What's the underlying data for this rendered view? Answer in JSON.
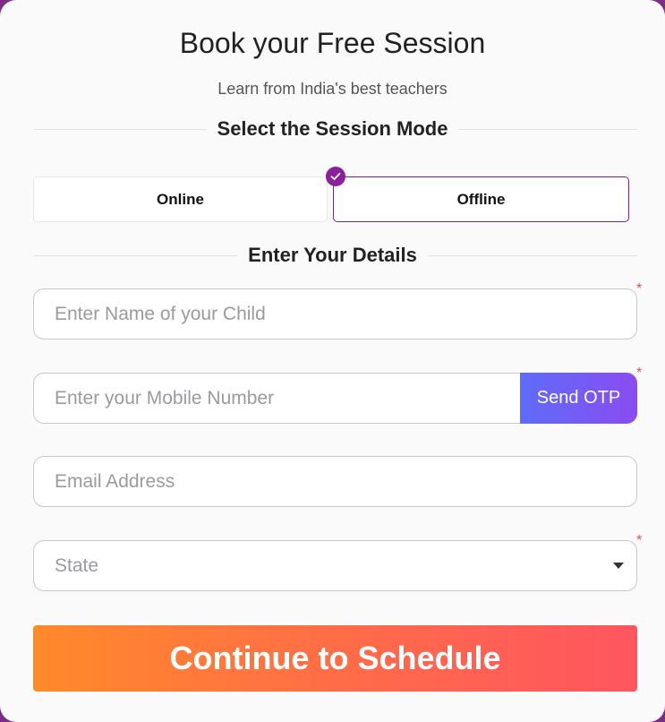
{
  "header": {
    "title": "Book your Free Session",
    "subtitle": "Learn from India's best teachers"
  },
  "session_mode": {
    "heading": "Select the Session Mode",
    "options": [
      {
        "label": "Online",
        "selected": false
      },
      {
        "label": "Offline",
        "selected": true
      }
    ]
  },
  "details": {
    "heading": "Enter Your Details",
    "name_placeholder": "Enter Name of your Child",
    "mobile_placeholder": "Enter your Mobile Number",
    "otp_label": "Send OTP",
    "email_placeholder": "Email Address",
    "state_placeholder": "State",
    "required_mark": "*"
  },
  "cta": {
    "label": "Continue to Schedule"
  },
  "colors": {
    "accent_purple": "#7b1e8f",
    "otp_gradient_start": "#5f6cf8",
    "otp_gradient_end": "#8a4cf1",
    "cta_gradient_start": "#ff8a2a",
    "cta_gradient_end": "#ff5560",
    "required": "#e0504a"
  },
  "icons": {
    "selected_check": "check-icon",
    "state_dropdown": "caret-down-icon"
  }
}
